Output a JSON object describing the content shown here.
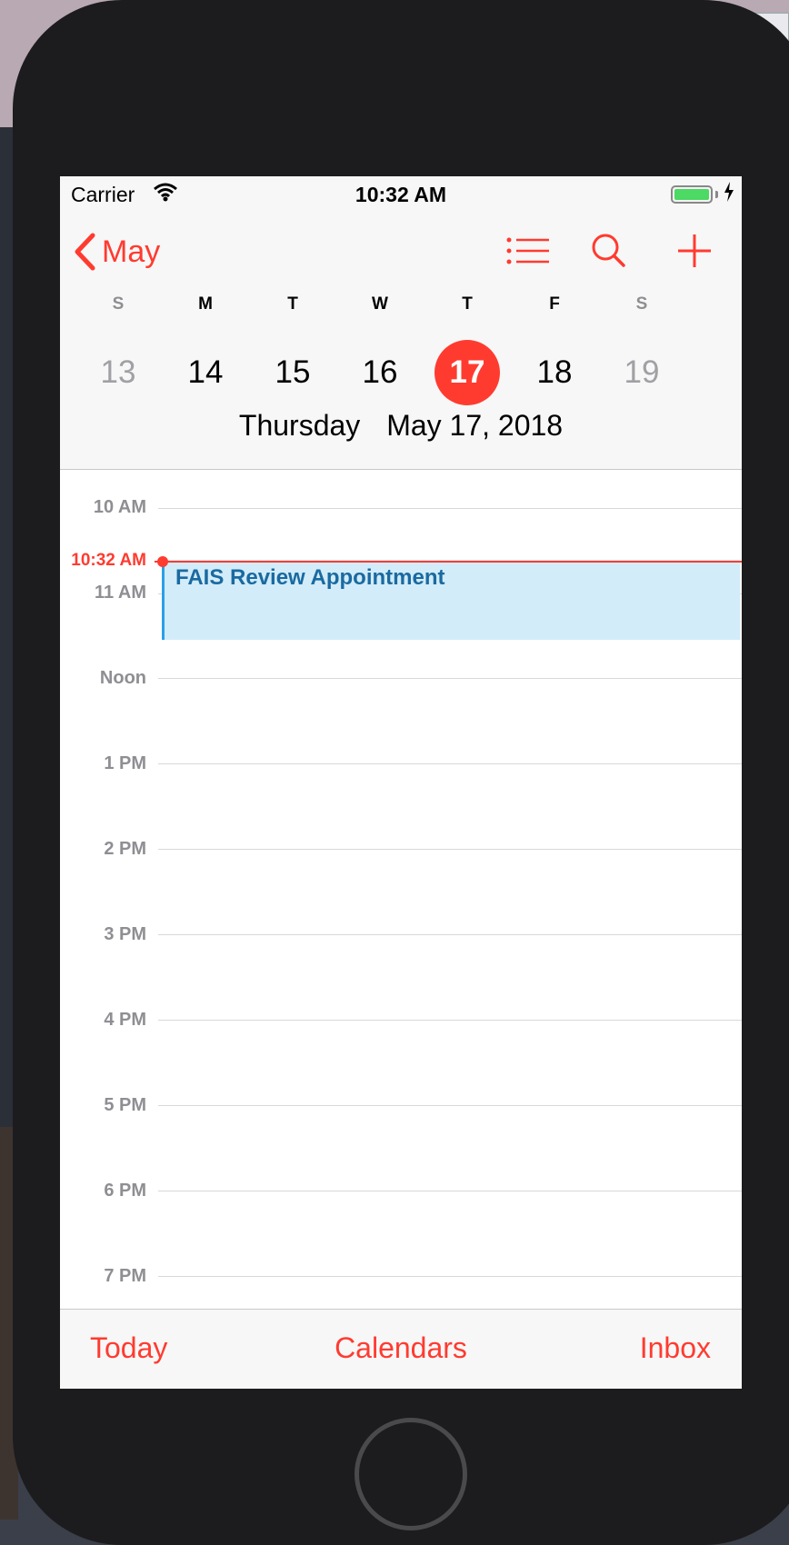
{
  "statusbar": {
    "carrier": "Carrier",
    "time": "10:32 AM"
  },
  "navbar": {
    "back_label": "May",
    "icons": [
      "list-icon",
      "search-icon",
      "plus-icon"
    ],
    "weekdays": [
      "S",
      "M",
      "T",
      "W",
      "T",
      "F",
      "S"
    ],
    "dates": [
      "13",
      "14",
      "15",
      "16",
      "17",
      "18",
      "19"
    ],
    "selected_date": "17",
    "day_name": "Thursday",
    "full_date": "May 17, 2018"
  },
  "dayview": {
    "hours": [
      "10 AM",
      "11 AM",
      "Noon",
      "1 PM",
      "2 PM",
      "3 PM",
      "4 PM",
      "5 PM",
      "6 PM",
      "7 PM"
    ],
    "current_time": "10:32 AM",
    "event": {
      "title": "FAIS Review Appointment"
    }
  },
  "tabbar": {
    "today": "Today",
    "calendars": "Calendars",
    "inbox": "Inbox"
  },
  "colors": {
    "accent": "#ff3b30",
    "event_bg": "#d2ecfa",
    "event_text": "#1a6aa0"
  }
}
